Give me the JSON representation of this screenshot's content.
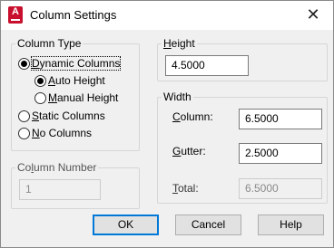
{
  "window": {
    "title": "Column Settings",
    "close_glyph": "✕",
    "app_icon_letter": "A"
  },
  "column_type": {
    "legend": "Column Type",
    "dynamic": {
      "label_ul": "D",
      "label_rest": "ynamic Columns",
      "checked": true
    },
    "auto_height": {
      "label_ul": "A",
      "label_rest": "uto Height",
      "checked": true
    },
    "manual_height": {
      "label_ul": "M",
      "label_rest": "anual Height",
      "checked": false
    },
    "static": {
      "label_ul": "S",
      "label_rest": "tatic Columns",
      "checked": false
    },
    "none": {
      "label_ul": "N",
      "label_rest": "o Columns",
      "checked": false
    }
  },
  "column_number": {
    "legend_ul": "C",
    "legend_mid": "o",
    "legend_ul2": "l",
    "legend_rest": "umn Number",
    "value": "1"
  },
  "height": {
    "legend_ul": "H",
    "legend_rest": "eight",
    "value": "4.5000"
  },
  "width": {
    "legend": "Width",
    "column_label_ul": "C",
    "column_label_rest": "olumn:",
    "column_value": "6.5000",
    "gutter_label_ul": "G",
    "gutter_label_rest": "utter:",
    "gutter_value": "2.5000",
    "total_label_ul": "T",
    "total_label_rest": "otal:",
    "total_value": "6.5000"
  },
  "buttons": {
    "ok": "OK",
    "cancel": "Cancel",
    "help": "Help"
  },
  "colors": {
    "accent": "#0078d7",
    "app_icon": "#c8102e"
  }
}
